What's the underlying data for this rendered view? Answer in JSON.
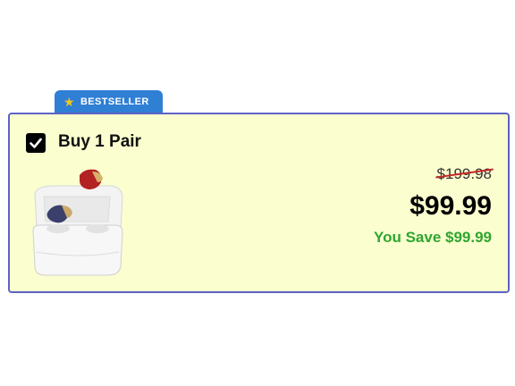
{
  "badge": {
    "label": "BESTSELLER",
    "icon": "star-icon"
  },
  "option": {
    "checked": true,
    "title": "Buy 1 Pair",
    "original_price": "$199.98",
    "sale_price": "$99.99",
    "savings": "You Save $99.99"
  },
  "colors": {
    "card_background": "#fbffcf",
    "card_border": "#5b63c5",
    "badge_background": "#2f7fd4",
    "savings_text": "#2fa52f",
    "strike_line": "#c62828"
  }
}
